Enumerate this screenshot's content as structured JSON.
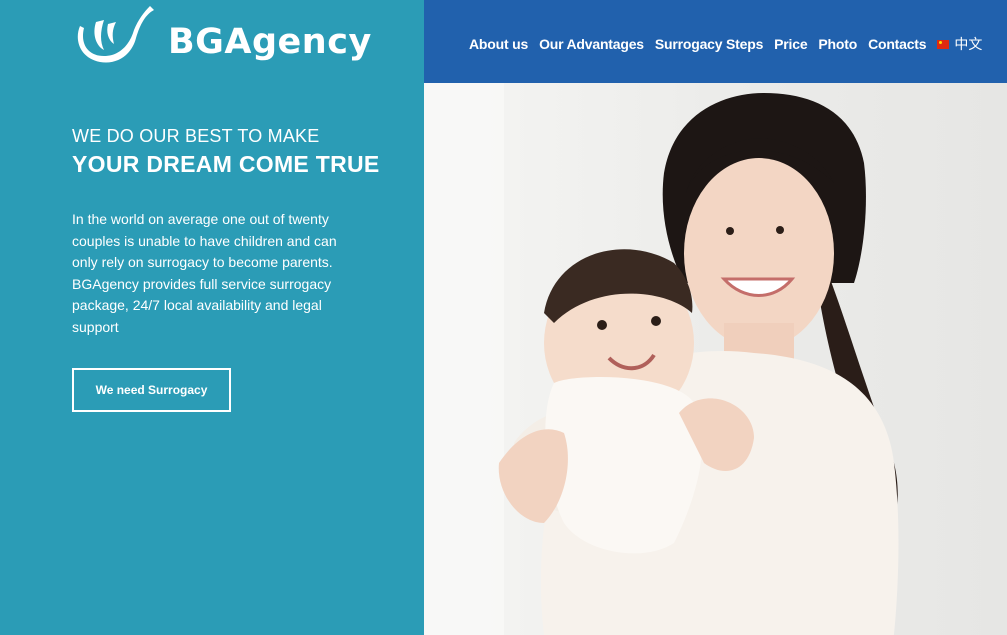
{
  "brand": {
    "name": "BGAgency"
  },
  "nav": {
    "items": [
      "About us",
      "Our Advantages",
      "Surrogacy Steps",
      "Price",
      "Photo",
      "Contacts"
    ],
    "language": "中文"
  },
  "hero": {
    "headline_small": "WE DO OUR BEST TO MAKE",
    "headline_big": "YOUR DREAM COME TRUE",
    "intro": "In the world on average one out of twenty couples is unable to have children and can only rely on surrogacy to become parents. BGAgency provides full service surrogacy package, 24/7 local availability and legal support",
    "cta_label": "We need Surrogacy"
  },
  "colors": {
    "left_panel": "#2b9cb6",
    "nav_bar": "#2161ad",
    "text": "#ffffff"
  },
  "icons": [
    "logo-mark-icon",
    "china-flag-icon"
  ]
}
